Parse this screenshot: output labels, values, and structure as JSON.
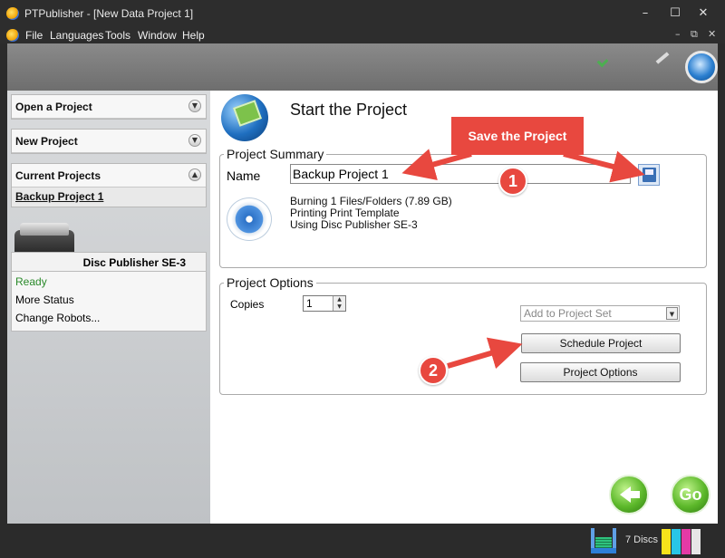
{
  "window": {
    "title": "PTPublisher - [New Data Project 1]",
    "minimize_glyph": "–",
    "maximize_glyph": "☐",
    "close_glyph": "✕"
  },
  "menu": {
    "items": [
      "File",
      "Languages",
      "Tools",
      "Window",
      "Help"
    ],
    "mdi_min": "–",
    "mdi_restore": "⧉",
    "mdi_close": "✕"
  },
  "sidebar": {
    "open_project": "Open a Project",
    "new_project": "New Project",
    "current_projects": "Current Projects",
    "current_project_link": "Backup Project 1",
    "robot_name": "Disc Publisher SE-3",
    "robot_status": "Ready",
    "more_status": "More Status",
    "change_robots": "Change Robots..."
  },
  "main": {
    "title": "Start the Project",
    "summary_legend": "Project Summary",
    "name_label": "Name",
    "name_value": "Backup Project 1",
    "summary_lines": [
      "Burning 1 Files/Folders (7.89 GB)",
      "Printing Print Template",
      "Using Disc Publisher SE-3"
    ],
    "options_legend": "Project Options",
    "copies_label": "Copies",
    "copies_value": "1",
    "project_set_placeholder": "Add to Project Set",
    "schedule_button": "Schedule Project",
    "options_button": "Project Options",
    "go_button": "Go"
  },
  "status": {
    "disc_count": "7 Discs"
  },
  "annotations": {
    "callout": "Save the Project",
    "marker1": "1",
    "marker2": "2",
    "color": "#e8483f"
  },
  "icons": [
    "app-icon",
    "save-icon",
    "disc-icon",
    "back-arrow-icon",
    "go-icon",
    "disc-stack-icon",
    "ink-icon",
    "chevron-down-icon",
    "chevron-up-icon",
    "globe-icon"
  ]
}
